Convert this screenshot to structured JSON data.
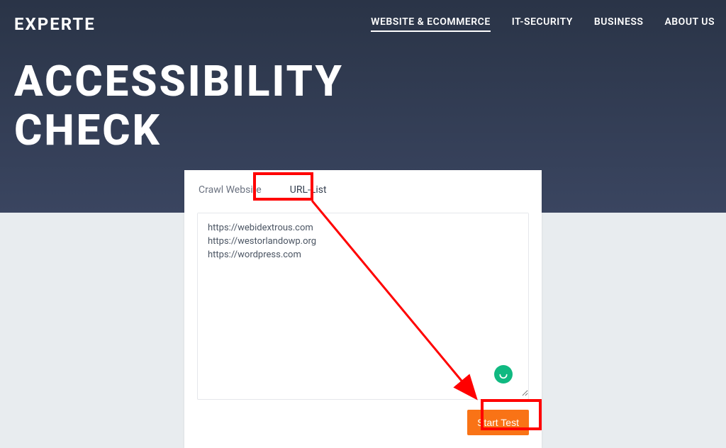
{
  "brand": "EXPERTE",
  "nav": {
    "items": [
      {
        "label": "WEBSITE & ECOMMERCE",
        "active": true
      },
      {
        "label": "IT-SECURITY",
        "active": false
      },
      {
        "label": "BUSINESS",
        "active": false
      },
      {
        "label": "ABOUT US",
        "active": false
      }
    ]
  },
  "page_title": "ACCESSIBILITY CHECK",
  "tabs": {
    "crawl": "Crawl Website",
    "urllist": "URL-List"
  },
  "textarea_value": "https://webidextrous.com\nhttps://westorlandowp.org\nhttps://wordpress.com",
  "start_button": "Start Test",
  "colors": {
    "accent": "#f97316",
    "chat": "#10b981",
    "annotation": "#ff0000"
  }
}
